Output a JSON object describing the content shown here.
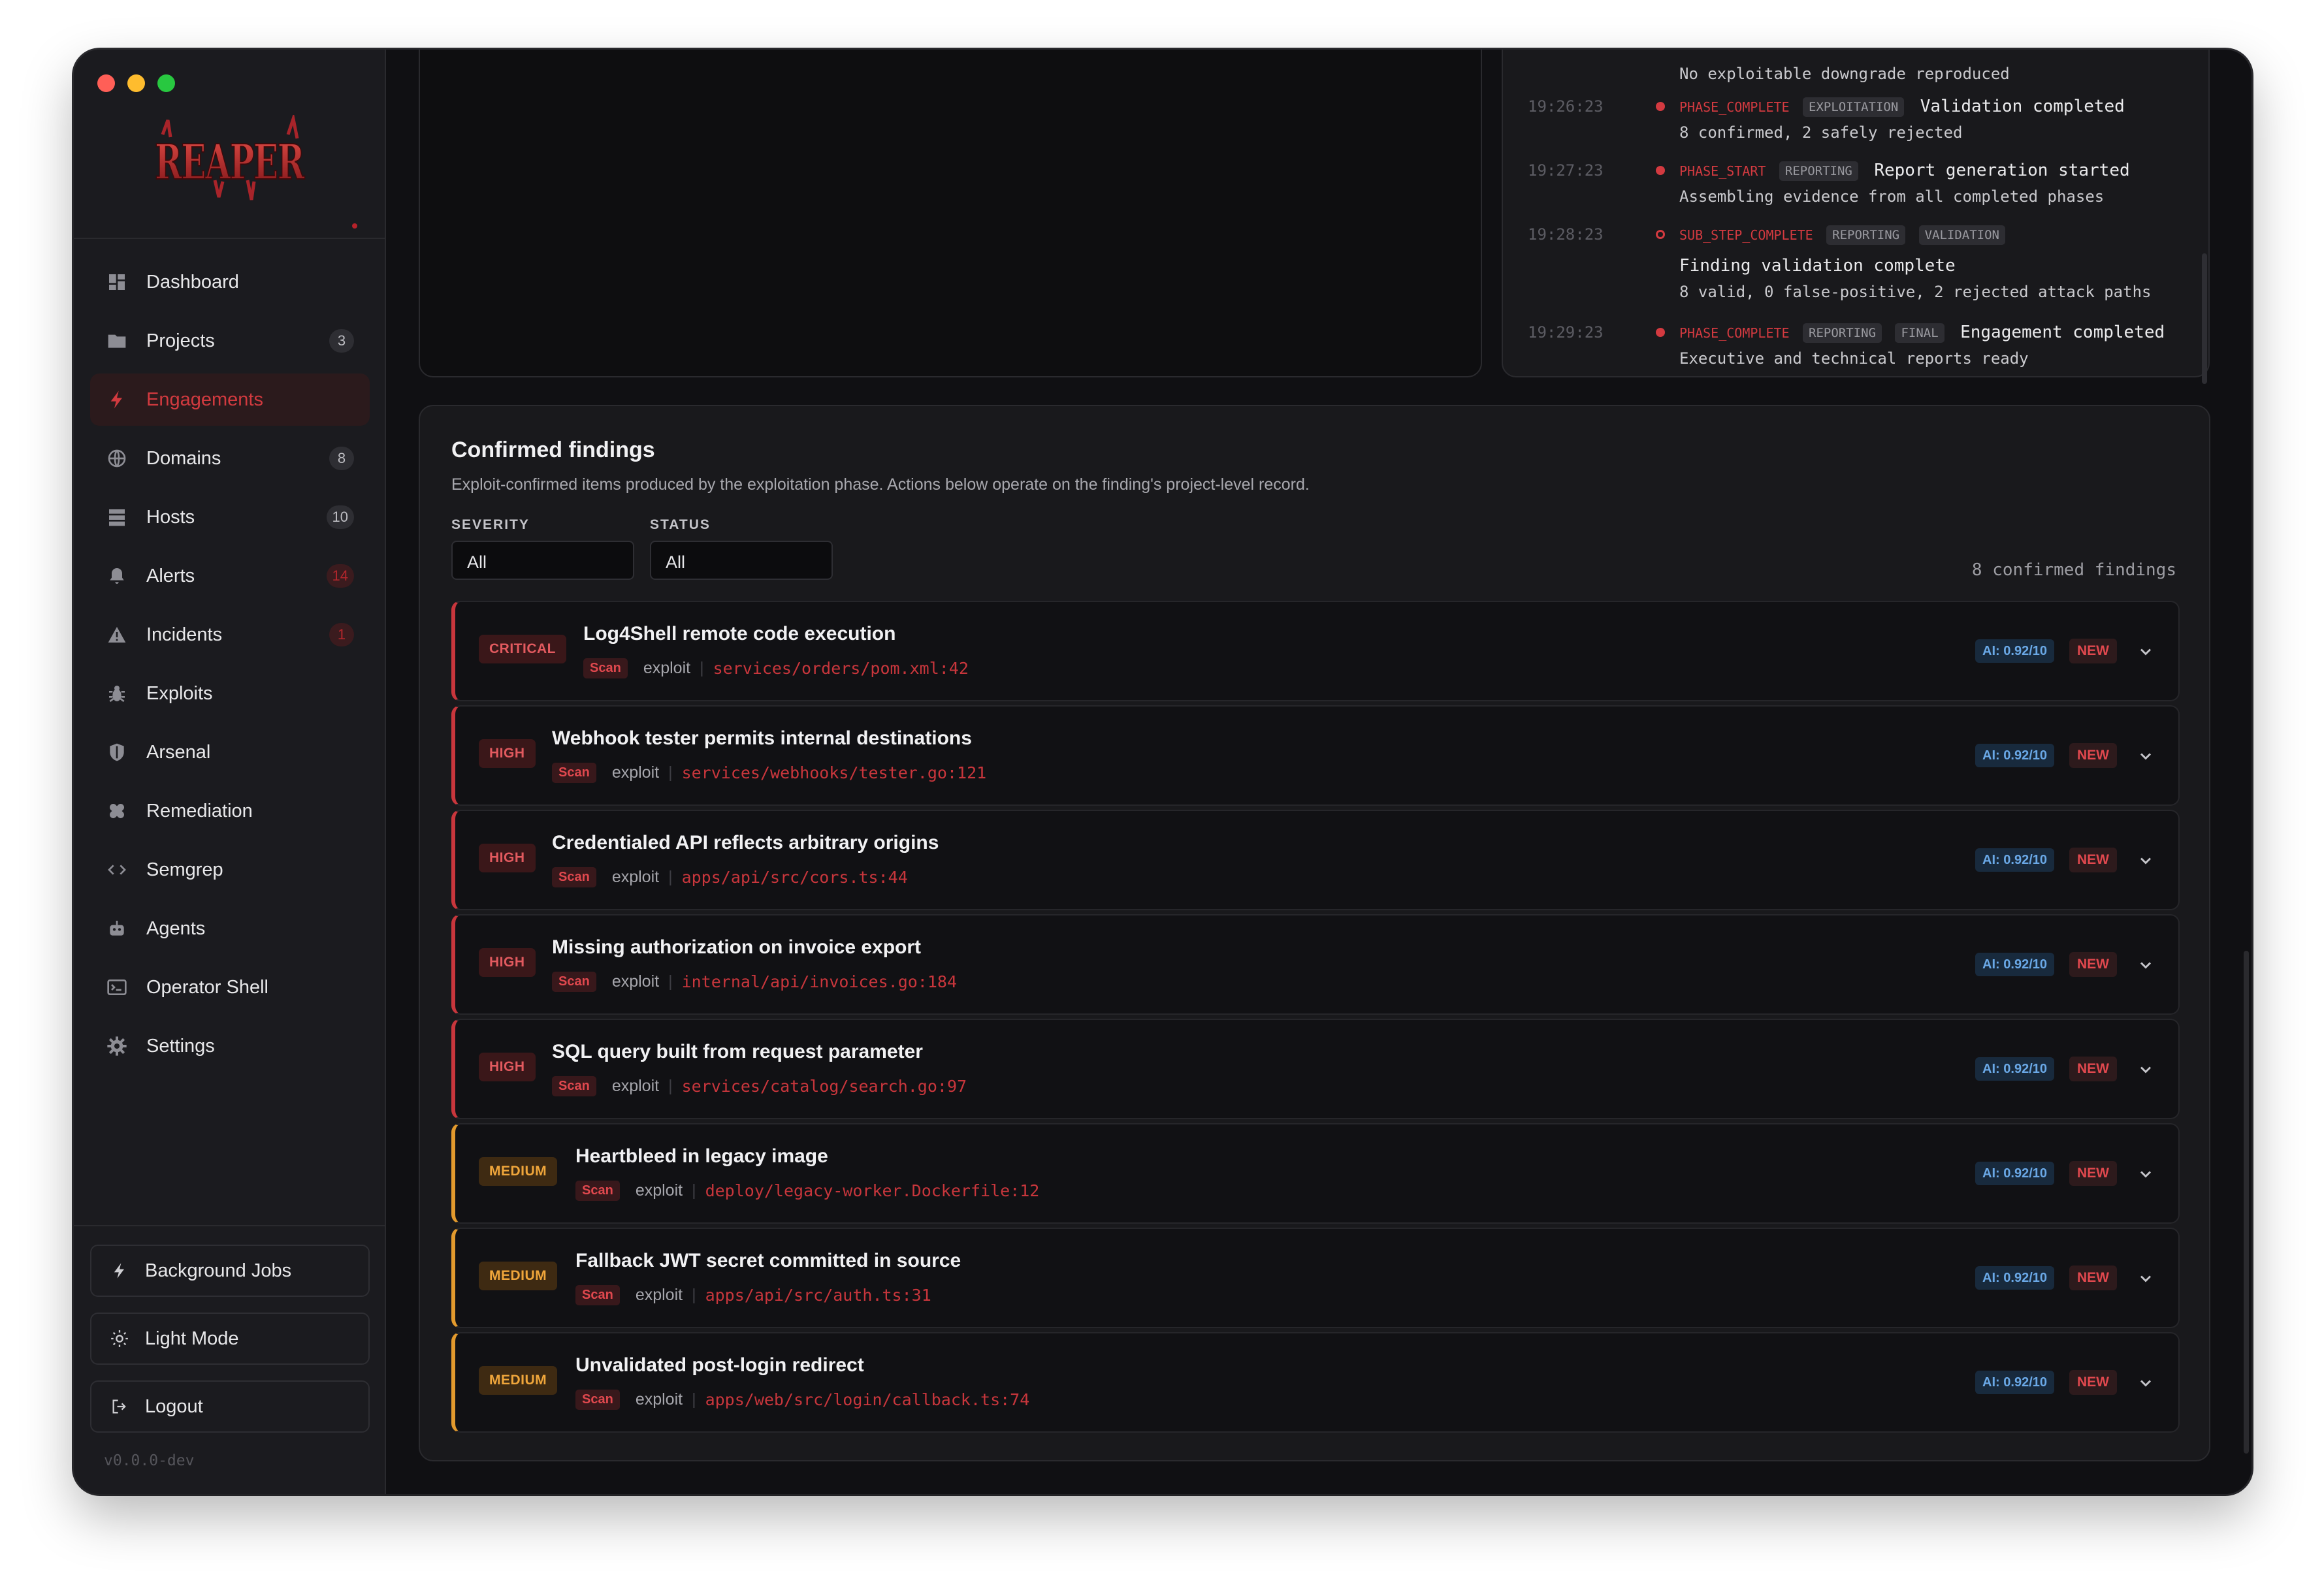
{
  "app": {
    "logo_text": "REAPER",
    "version": "v0.0.0-dev"
  },
  "sidebar": {
    "items": [
      {
        "label": "Dashboard",
        "icon": "dashboard-icon",
        "badge": ""
      },
      {
        "label": "Projects",
        "icon": "folder-icon",
        "badge": "3"
      },
      {
        "label": "Engagements",
        "icon": "bolt-icon",
        "badge": "",
        "active": true
      },
      {
        "label": "Domains",
        "icon": "globe-icon",
        "badge": "8"
      },
      {
        "label": "Hosts",
        "icon": "server-icon",
        "badge": "10"
      },
      {
        "label": "Alerts",
        "icon": "bell-icon",
        "badge": "14"
      },
      {
        "label": "Incidents",
        "icon": "warning-icon",
        "badge": "1"
      },
      {
        "label": "Exploits",
        "icon": "bug-icon",
        "badge": ""
      },
      {
        "label": "Arsenal",
        "icon": "shield-icon",
        "badge": ""
      },
      {
        "label": "Remediation",
        "icon": "bandage-icon",
        "badge": ""
      },
      {
        "label": "Semgrep",
        "icon": "code-icon",
        "badge": ""
      },
      {
        "label": "Agents",
        "icon": "robot-icon",
        "badge": ""
      },
      {
        "label": "Operator Shell",
        "icon": "terminal-icon",
        "badge": ""
      },
      {
        "label": "Settings",
        "icon": "gear-icon",
        "badge": ""
      }
    ],
    "footer": {
      "background_jobs": "Background Jobs",
      "light_mode": "Light Mode",
      "logout": "Logout"
    }
  },
  "activity_log": {
    "entries": [
      {
        "time": "",
        "event": "",
        "tags": [],
        "headline": "",
        "detail": "No exploitable downgrade reproduced"
      },
      {
        "time": "19:26:23",
        "event": "PHASE_COMPLETE",
        "tags": [
          "EXPLOITATION"
        ],
        "headline": "Validation completed",
        "detail": "8 confirmed, 2 safely rejected"
      },
      {
        "time": "19:27:23",
        "event": "PHASE_START",
        "tags": [
          "REPORTING"
        ],
        "headline": "Report generation started",
        "detail": "Assembling evidence from all completed phases"
      },
      {
        "time": "19:28:23",
        "event": "SUB_STEP_COMPLETE",
        "tags": [
          "REPORTING",
          "VALIDATION"
        ],
        "headline": "Finding validation complete",
        "detail": "8 valid, 0 false-positive, 2 rejected attack paths"
      },
      {
        "time": "19:29:23",
        "event": "PHASE_COMPLETE",
        "tags": [
          "REPORTING",
          "FINAL"
        ],
        "headline": "Engagement completed",
        "detail": "Executive and technical reports ready"
      }
    ]
  },
  "findings": {
    "title": "Confirmed findings",
    "description": "Exploit-confirmed items produced by the exploitation phase. Actions below operate on the finding's project-level record.",
    "filters": {
      "severity_label": "SEVERITY",
      "severity_value": "All",
      "status_label": "STATUS",
      "status_value": "All"
    },
    "count_text": "8 confirmed findings",
    "items": [
      {
        "severity": "CRITICAL",
        "title": "Log4Shell remote code execution",
        "source": "Scan",
        "kind": "exploit",
        "path": "services/orders/pom.xml:42",
        "ai": "AI: 0.92/10",
        "status": "NEW"
      },
      {
        "severity": "HIGH",
        "title": "Webhook tester permits internal destinations",
        "source": "Scan",
        "kind": "exploit",
        "path": "services/webhooks/tester.go:121",
        "ai": "AI: 0.92/10",
        "status": "NEW"
      },
      {
        "severity": "HIGH",
        "title": "Credentialed API reflects arbitrary origins",
        "source": "Scan",
        "kind": "exploit",
        "path": "apps/api/src/cors.ts:44",
        "ai": "AI: 0.92/10",
        "status": "NEW"
      },
      {
        "severity": "HIGH",
        "title": "Missing authorization on invoice export",
        "source": "Scan",
        "kind": "exploit",
        "path": "internal/api/invoices.go:184",
        "ai": "AI: 0.92/10",
        "status": "NEW"
      },
      {
        "severity": "HIGH",
        "title": "SQL query built from request parameter",
        "source": "Scan",
        "kind": "exploit",
        "path": "services/catalog/search.go:97",
        "ai": "AI: 0.92/10",
        "status": "NEW"
      },
      {
        "severity": "MEDIUM",
        "title": "Heartbleed in legacy image",
        "source": "Scan",
        "kind": "exploit",
        "path": "deploy/legacy-worker.Dockerfile:12",
        "ai": "AI: 0.92/10",
        "status": "NEW"
      },
      {
        "severity": "MEDIUM",
        "title": "Fallback JWT secret committed in source",
        "source": "Scan",
        "kind": "exploit",
        "path": "apps/api/src/auth.ts:31",
        "ai": "AI: 0.92/10",
        "status": "NEW"
      },
      {
        "severity": "MEDIUM",
        "title": "Unvalidated post-login redirect",
        "source": "Scan",
        "kind": "exploit",
        "path": "apps/web/src/login/callback.ts:74",
        "ai": "AI: 0.92/10",
        "status": "NEW"
      }
    ]
  },
  "colors": {
    "accent": "#d13a3f",
    "critical": "#e0484e",
    "high": "#e0484e",
    "medium": "#f0a63b",
    "ai": "#6aa8e6"
  }
}
